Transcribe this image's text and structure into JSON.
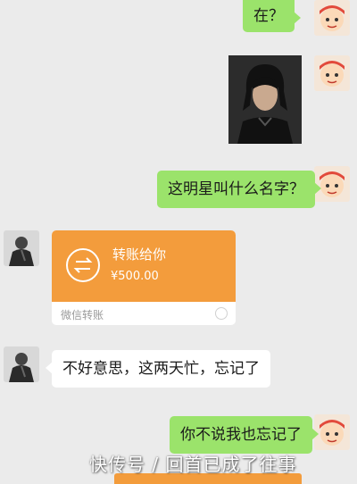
{
  "messages": [
    {
      "side": "right",
      "type": "text",
      "text": "在？"
    },
    {
      "side": "right",
      "type": "image",
      "image": "celebrity-photo"
    },
    {
      "side": "right",
      "type": "text",
      "text": "这明星叫什么名字？"
    },
    {
      "side": "left",
      "type": "transfer",
      "title": "转账给你",
      "amount": "¥500.00",
      "footer": "微信转账"
    },
    {
      "side": "left",
      "type": "text",
      "text": "不好意思，这两天忙，忘记了"
    },
    {
      "side": "right",
      "type": "text",
      "text": "你不说我也忘记了"
    }
  ],
  "watermark": "快传号 / 回首已成了往事",
  "colors": {
    "background": "#ebebeb",
    "sent_bubble": "#9be36b",
    "received_bubble": "#ffffff",
    "transfer_card": "#f39c3c"
  }
}
